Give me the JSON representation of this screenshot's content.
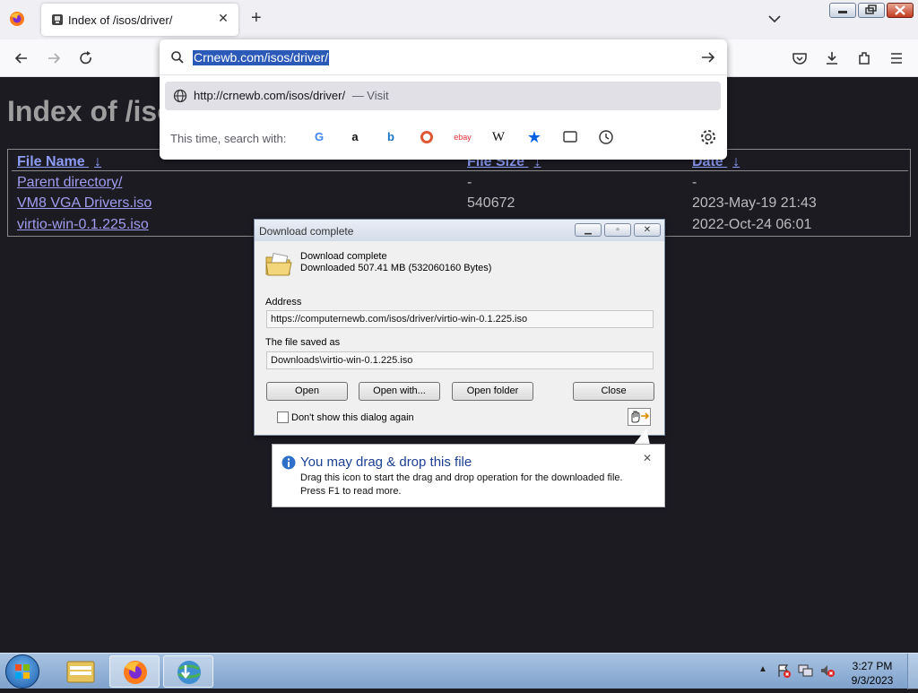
{
  "browser": {
    "tab": {
      "title": "Index of /isos/driver/",
      "close": "✕"
    },
    "new_tab": "+",
    "url_text": "Crnewb.com/isos/driver/",
    "suggestion": {
      "url": "http://crnewb.com/isos/driver/",
      "action": "— Visit"
    },
    "search_with_label": "This time, search with:",
    "engines": [
      "google-icon",
      "amazon-icon",
      "bing-icon",
      "duckduckgo-icon",
      "ebay-icon",
      "wikipedia-icon",
      "bookmarks-icon",
      "tabs-icon",
      "history-icon"
    ]
  },
  "page": {
    "heading": "Index of /isos/driver/",
    "columns": [
      {
        "label": "File Name",
        "sort": "↓"
      },
      {
        "label": "File Size",
        "sort": "↓"
      },
      {
        "label": "Date",
        "sort": "↓"
      }
    ],
    "rows": [
      {
        "name": "Parent directory/",
        "size": "-",
        "date": "-"
      },
      {
        "name": "VM8 VGA Drivers.iso",
        "size": "540672",
        "date": "2023-May-19 21:43"
      },
      {
        "name": "virtio-win-0.1.225.iso",
        "size": "",
        "date": "2022-Oct-24 06:01"
      }
    ]
  },
  "dialog": {
    "title": "Download complete",
    "heading": "Download complete",
    "subheading": "Downloaded 507.41  MB (532060160 Bytes)",
    "address_label": "Address",
    "address_value": "https://computernewb.com/isos/driver/virtio-win-0.1.225.iso",
    "saved_label": "The file saved as",
    "saved_value": "Downloads\\virtio-win-0.1.225.iso",
    "buttons": {
      "open": "Open",
      "open_with": "Open with...",
      "open_folder": "Open folder",
      "close": "Close"
    },
    "checkbox_label": "Don't show this dialog again",
    "checkbox_checked": false
  },
  "balloon": {
    "title": "You may drag & drop this file",
    "line1": "Drag this icon to start the drag and drop operation for the downloaded file.",
    "line2": "Press F1 to read more.",
    "close": "✕"
  },
  "taskbar": {
    "time": "3:27 PM",
    "date": "9/3/2023"
  },
  "colors": {
    "accent": "#2a59b8",
    "link": "#a09cf0",
    "page_bg": "#1c1b22"
  }
}
